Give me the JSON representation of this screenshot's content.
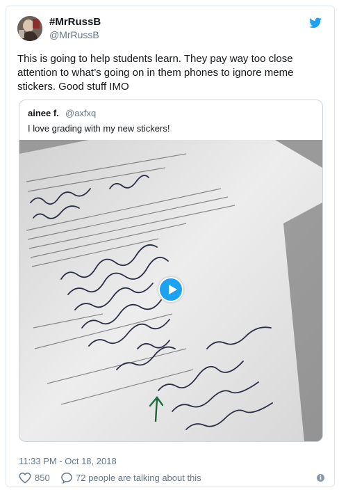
{
  "tweet": {
    "display_name": "#MrRussB",
    "handle": "@MrRussB",
    "text": "This is going to help students learn. They pay way too close attention to what’s going on in them phones to ignore meme stickers. Good stuff IMO",
    "timestamp": "11:33 PM - Oct 18, 2018",
    "likes": "850",
    "talking": "72 people are talking about this"
  },
  "quoted": {
    "display_name": "ainee f.",
    "handle": "@axfxq",
    "text": "I love grading with my new stickers!"
  },
  "icons": {
    "brand": "twitter-bird-icon",
    "like": "heart-icon",
    "reply": "speech-bubble-icon",
    "info": "info-icon",
    "media_play": "play-icon"
  },
  "colors": {
    "brand_blue": "#1da1f2",
    "secondary_text": "#657786",
    "border": "#e1e8ed"
  }
}
